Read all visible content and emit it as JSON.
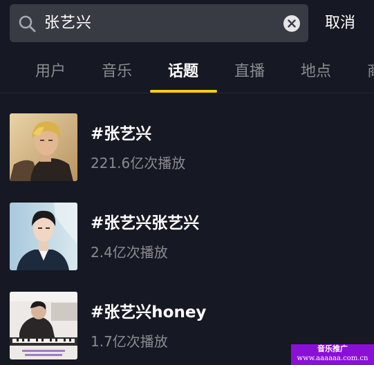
{
  "search": {
    "query": "张艺兴",
    "cancel_label": "取消"
  },
  "tabs": [
    {
      "label": "用户"
    },
    {
      "label": "音乐"
    },
    {
      "label": "话题"
    },
    {
      "label": "直播"
    },
    {
      "label": "地点"
    },
    {
      "label": "商"
    }
  ],
  "active_tab": "话题",
  "results": [
    {
      "title": "#张艺兴",
      "meta": "221.6亿次播放"
    },
    {
      "title": "#张艺兴张艺兴",
      "meta": "2.4亿次播放"
    },
    {
      "title": "#张艺兴honey",
      "meta": "1.7亿次播放"
    }
  ],
  "watermark": {
    "line1": "音乐推广",
    "line2": "www.aaaaaa.com.cn"
  },
  "colors": {
    "background": "#161823",
    "accent": "#face15",
    "search_bg": "#393b44",
    "muted_text": "#8a8b91",
    "watermark_bg": "#8a10d6"
  },
  "icons": [
    "search-icon",
    "clear-icon"
  ]
}
